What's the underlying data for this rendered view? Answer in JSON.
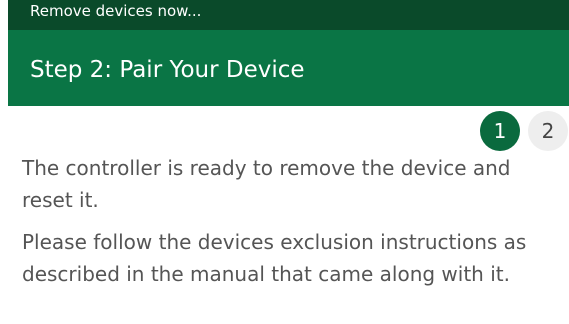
{
  "status_bar": {
    "text": "Remove devices now..."
  },
  "header": {
    "title": "Step 2: Pair Your Device"
  },
  "steps": [
    {
      "label": "1",
      "active": true
    },
    {
      "label": "2",
      "active": false
    }
  ],
  "content": {
    "paragraph1": "The controller is ready to remove the device and reset it.",
    "paragraph2": "Please follow the devices exclusion instructions as described in the manual that came along with it."
  },
  "colors": {
    "status_bar_bg": "#0a4a2a",
    "header_bg": "#0a7545",
    "step_active_bg": "#0a6a3e",
    "step_inactive_bg": "#eeeeee",
    "body_text": "#555555"
  }
}
